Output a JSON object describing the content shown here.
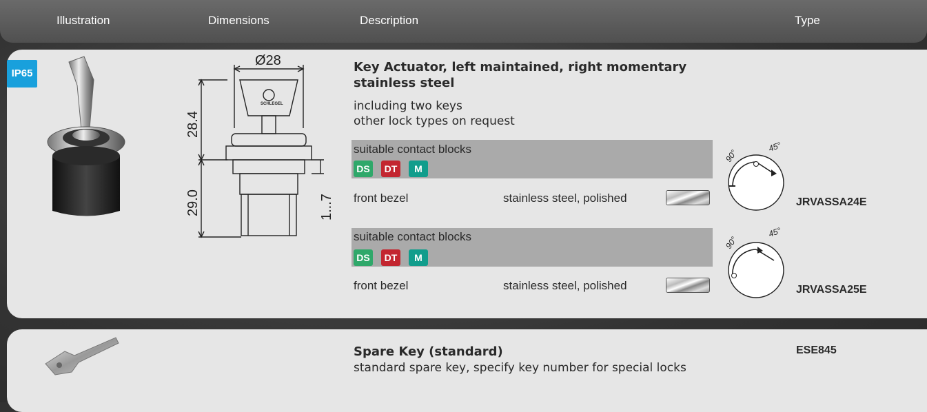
{
  "header": {
    "col_illustration": "Illustration",
    "col_dimensions": "Dimensions",
    "col_description": "Description",
    "col_type": "Type"
  },
  "product1": {
    "badge": "IP65",
    "title_line1": "Key Actuator, left maintained, right momentary",
    "title_line2": "stainless steel",
    "desc_line1": "including two keys",
    "desc_line2": "other lock types on request",
    "dims": {
      "diameter": "Ø28",
      "height_top": "28.4",
      "height_bottom": "29.0",
      "panel": "1...7",
      "key_brand": "SCHLEGEL"
    },
    "variants": [
      {
        "contact_label": "suitable contact blocks",
        "badges": [
          "DS",
          "DT",
          "M"
        ],
        "bezel_label": "front bezel",
        "bezel_material": "stainless steel, polished",
        "angle_left": "90°",
        "angle_right": "45°",
        "code": "JRVASSA24E"
      },
      {
        "contact_label": "suitable contact blocks",
        "badges": [
          "DS",
          "DT",
          "M"
        ],
        "bezel_label": "front bezel",
        "bezel_material": "stainless steel, polished",
        "angle_left": "90°",
        "angle_right": "45°",
        "code": "JRVASSA25E"
      }
    ]
  },
  "product2": {
    "title": "Spare Key (standard)",
    "desc": "standard spare key, specify key number for special locks",
    "code": "ESE845"
  },
  "colors": {
    "ip_badge": "#19a0dc",
    "ds": "#2fa86a",
    "dt": "#c32630",
    "m": "#119d8c"
  }
}
